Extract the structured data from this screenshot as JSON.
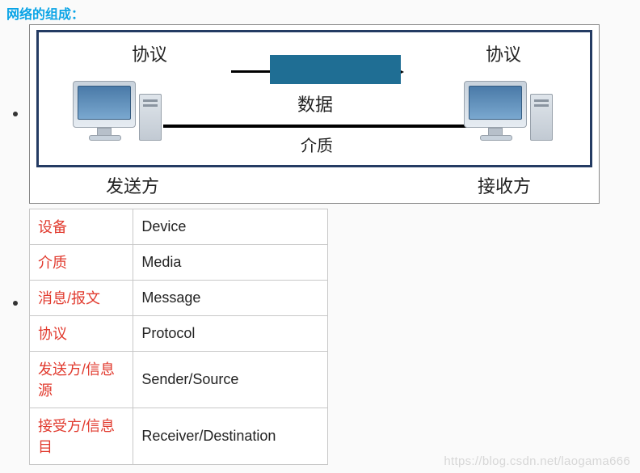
{
  "title": "网络的组成：",
  "diagram": {
    "protocol_left": "协议",
    "protocol_right": "协议",
    "data_label": "数据",
    "medium_label": "介质",
    "sender_label": "发送方",
    "receiver_label": "接收方"
  },
  "table": {
    "rows": [
      {
        "cn": "设备",
        "en": "Device"
      },
      {
        "cn": "介质",
        "en": "Media"
      },
      {
        "cn": "消息/报文",
        "en": "Message"
      },
      {
        "cn": "协议",
        "en": "Protocol"
      },
      {
        "cn": "发送方/信息源",
        "en": "Sender/Source"
      },
      {
        "cn": "接受方/信息目",
        "en": "Receiver/Destination"
      }
    ]
  },
  "watermark": "https://blog.csdn.net/laogama666"
}
